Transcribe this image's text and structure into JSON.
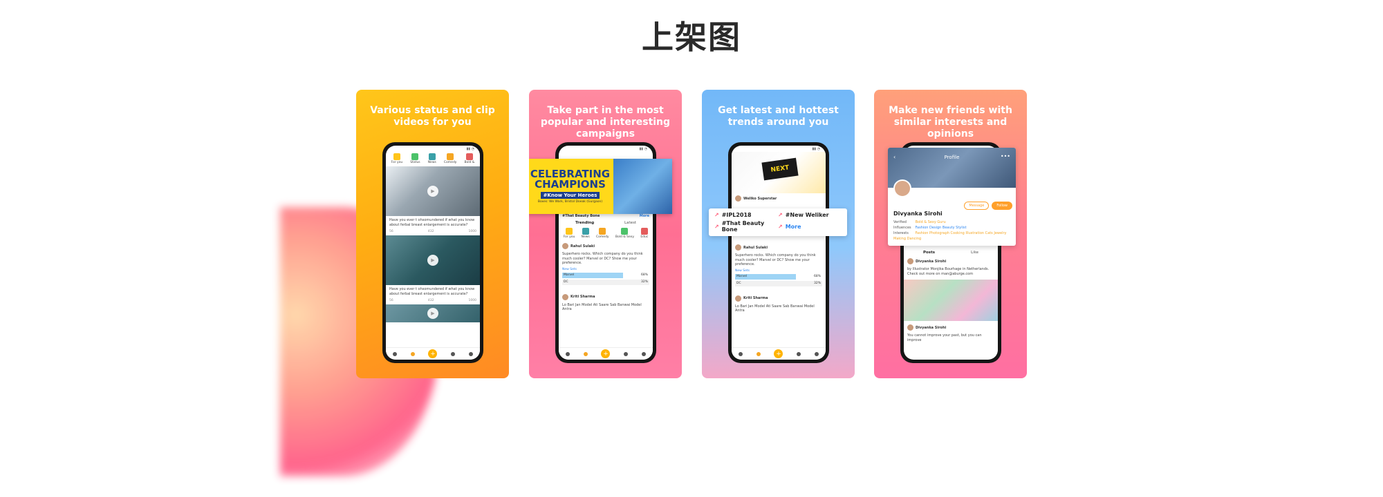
{
  "page": {
    "title": "上架图"
  },
  "cards": [
    {
      "caption": "Various status and clip videos for you",
      "tabs": [
        "For you",
        "Status",
        "News",
        "Comedy",
        "Bold &"
      ],
      "posts": [
        {
          "text": "Have you ever t ohsomundered if what you know about ferbal breast enlargement is accurate?",
          "likes": "432",
          "comments": "56",
          "shares": "1000"
        },
        {
          "text": "Have you ever t ohsomundered if what you know about ferbal breast enlargement is accurate?",
          "likes": "432",
          "comments": "56",
          "shares": "1000"
        }
      ],
      "nav": [
        "Home",
        "Discover",
        "+",
        "Messages",
        "Me"
      ]
    },
    {
      "caption": "Take part in the most popular and interesting campaigns",
      "banner": {
        "headline": "CELEBRATING CHAMPIONS",
        "tag": "#Know Your Heroes",
        "sub": "Boxes: We Wark, Bristol Doeak (Gurgaon)"
      },
      "trend_left": "#That Beauty Bone",
      "trend_right": "More",
      "segments": [
        "Trending",
        "Latest"
      ],
      "tabs": [
        "For you",
        "News",
        "Comedy",
        "Bold & Sexy",
        "Educ"
      ],
      "user1": "Rahul Sulaki",
      "question": "Superhero rocks. Which company do you think much cooler? Marvel or DC? Show me your preference.",
      "new_sets": "New Sets",
      "options": [
        {
          "label": "Marvel",
          "pct": "68%"
        },
        {
          "label": "DC",
          "pct": "32%"
        }
      ],
      "user2": "Kriti Sharma",
      "user2_text": "Lo Bari Jan Model Ati Saare Sab Banwai Model Antra"
    },
    {
      "caption": "Get latest and hottest trends around you",
      "account": "Weliko Superstar",
      "trends": [
        "#IPL2018",
        "#New Weliker",
        "#That Beauty Bone",
        "More"
      ],
      "user1": "Rahul Sulaki",
      "question": "Superhero rocks. Which company do you think much cooler? Marvel or DC? Show me your preference.",
      "new_sets": "New Sets",
      "options": [
        {
          "label": "Marvel",
          "pct": "68%"
        },
        {
          "label": "DC",
          "pct": "32%"
        }
      ],
      "user2": "Kriti Sharma",
      "user2_text": "Lo Bari Jan Model Ati Saare Sab Banwai Model Antra"
    },
    {
      "caption": "Make new friends with similar interests and opinions",
      "profile_title": "Profile",
      "name": "Divyanka Sirohi",
      "buttons": [
        "Message",
        "Follow"
      ],
      "info": [
        {
          "key": "Verified",
          "value": "Bold & Sexy Guru"
        },
        {
          "key": "Influences",
          "value": "Fashion Design Beauty Stylist"
        },
        {
          "key": "Interests",
          "value": "Fashion Photograph Cooking Illustration Cats Jewelry Making Dancing"
        }
      ],
      "post_tabs": [
        "Posts",
        "Like"
      ],
      "post_user": "Divyanka Sirohi",
      "post_text": "by Illustrator Monjika Bourhage in Netherlands. Check out more on man@aburge.com",
      "post_user2": "Divyanka Sirohi",
      "post_text2": "You cannot improve your past, but you can improve"
    }
  ]
}
